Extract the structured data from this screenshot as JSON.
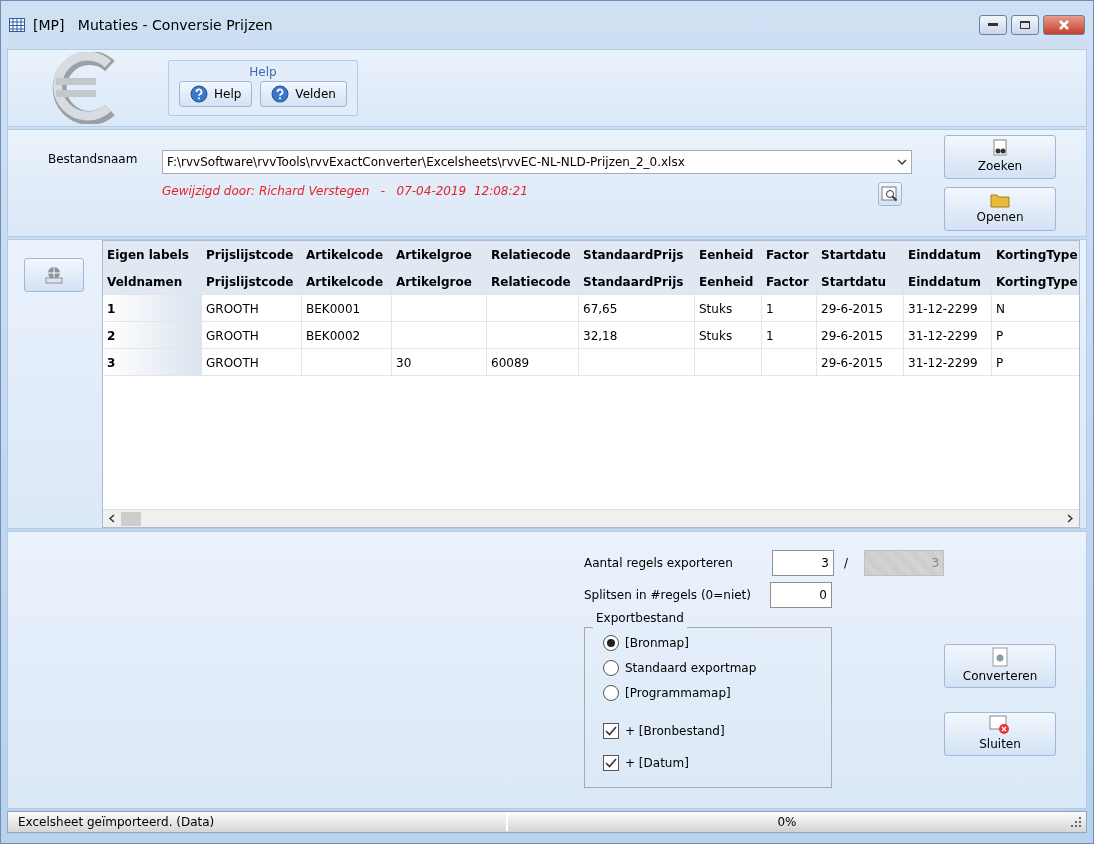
{
  "window": {
    "title": "[MP]   Mutaties - Conversie Prijzen"
  },
  "help_group": {
    "title": "Help",
    "buttons": [
      "Help",
      "Velden"
    ]
  },
  "file": {
    "label": "Bestandsnaam",
    "value": "F:\\rvvSoftware\\rvvTools\\rvvExactConverter\\Excelsheets\\rvvEC-NL-NLD-Prijzen_2_0.xlsx",
    "modified": "Gewijzigd door: Richard Verstegen   -   07-04-2019  12:08:21",
    "buttons": [
      "Zoeken",
      "Openen"
    ]
  },
  "grid": {
    "header_rows": [
      [
        "Eigen labels",
        "Prijslijstcode",
        "Artikelcode",
        "Artikelgroe",
        "Relatiecode",
        "StandaardPrijs",
        "Eenheid",
        "Factor",
        "Startdatu",
        "Einddatum",
        "KortingType"
      ],
      [
        "Veldnamen",
        "Prijslijstcode",
        "Artikelcode",
        "Artikelgroe",
        "Relatiecode",
        "StandaardPrijs",
        "Eenheid",
        "Factor",
        "Startdatu",
        "Einddatum",
        "KortingType"
      ]
    ],
    "rows": [
      [
        "1",
        "GROOTH",
        "BEK0001",
        "",
        "",
        "67,65",
        "Stuks",
        "1",
        "29-6-2015",
        "31-12-2299",
        "N"
      ],
      [
        "2",
        "GROOTH",
        "BEK0002",
        "",
        "",
        "32,18",
        "Stuks",
        "1",
        "29-6-2015",
        "31-12-2299",
        "P"
      ],
      [
        "3",
        "GROOTH",
        "",
        "30",
        "60089",
        "",
        "",
        "",
        "29-6-2015",
        "31-12-2299",
        "P"
      ]
    ]
  },
  "export": {
    "count_label": "Aantal regels exporteren",
    "count_value": "3",
    "separator": "/",
    "total_value": "3",
    "split_label": "Splitsen in #regels (0=niet)",
    "split_value": "0",
    "group_title": "Exportbestand",
    "options": [
      {
        "kind": "radio",
        "label": "[Bronmap]",
        "selected": true
      },
      {
        "kind": "radio",
        "label": "Standaard exportmap",
        "selected": false
      },
      {
        "kind": "radio",
        "label": "[Programmamap]",
        "selected": false
      },
      {
        "kind": "checkbox",
        "label": "+ [Bronbestand]",
        "checked": true
      },
      {
        "kind": "checkbox",
        "label": "+ [Datum]",
        "checked": true
      }
    ],
    "buttons": [
      "Converteren",
      "Sluiten"
    ]
  },
  "status_bar": {
    "text": "Excelsheet geïmporteerd. (Data)",
    "progress": {
      "level": 0,
      "reading": "0%"
    }
  }
}
